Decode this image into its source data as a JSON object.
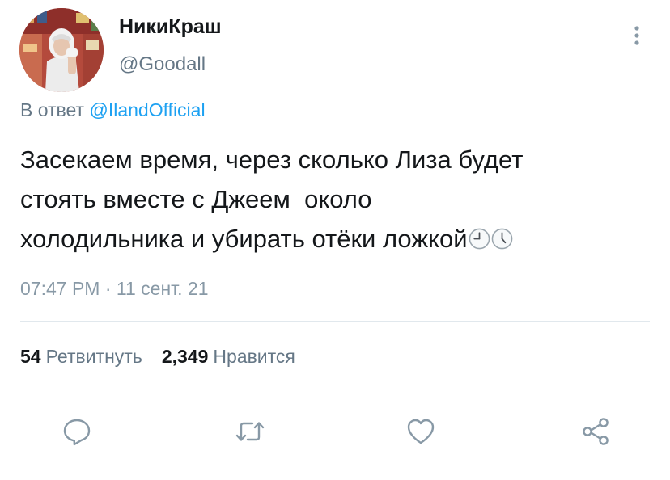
{
  "tweet": {
    "author": {
      "display_name": "НикиКраш",
      "handle": "@Goodall"
    },
    "reply": {
      "prefix": "В ответ",
      "mention": "@IlandOfficial"
    },
    "text_lines": [
      "Засекаем время, через сколько Лиза будет",
      "стоять вместе с Джеем  около",
      "холодильника  и убирать отёки ложкой"
    ],
    "trailing_emoji": [
      "clock-emoji",
      "clock-emoji"
    ],
    "timestamp": "07:47 PM · 11 сент. 21",
    "stats": {
      "retweets_count": "54",
      "retweets_label": "Ретвитнуть",
      "likes_count": "2,349",
      "likes_label": "Нравится"
    }
  },
  "actions": [
    "reply-icon",
    "retweet-icon",
    "like-icon",
    "share-icon"
  ],
  "colors": {
    "text": "#14171a",
    "secondary": "#657786",
    "link": "#1da1f2",
    "icon": "#8899a6",
    "divider": "#e1e8ed"
  }
}
